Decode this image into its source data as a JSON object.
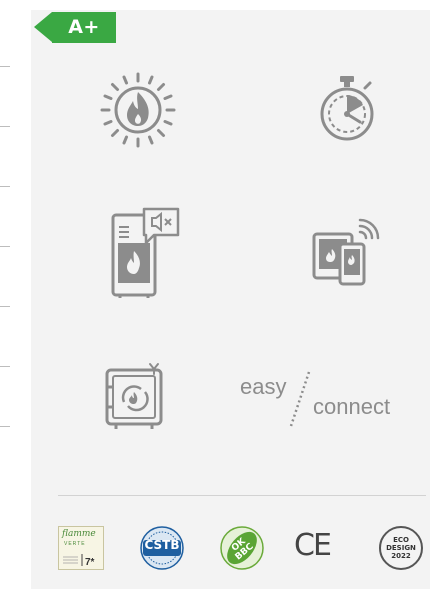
{
  "energy_label": {
    "grade": "A+",
    "color": "#3aa843"
  },
  "features": [
    {
      "icon": "flame-heat-icon"
    },
    {
      "icon": "timer-icon"
    },
    {
      "icon": "silent-stove-icon"
    },
    {
      "icon": "tablet-phone-wifi-icon"
    },
    {
      "icon": "safe-cycle-icon"
    }
  ],
  "easyconnect": {
    "part1": "easy",
    "part2": "connect"
  },
  "certifications": {
    "flamme_verte": {
      "title": "flamme",
      "sub": "VERTE",
      "rating": "7*"
    },
    "cstb": "CSTB",
    "ok_bbc": "OK BBC",
    "ce": "CE",
    "eco_design": [
      "ECO",
      "DESIGN",
      "2022"
    ]
  },
  "colors": {
    "icon_gray": "#8c8c8c",
    "panel_bg": "#f3f3f3",
    "accent_green": "#3aa843"
  }
}
